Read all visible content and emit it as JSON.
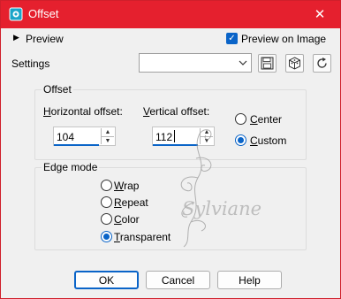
{
  "window": {
    "title": "Offset",
    "close_glyph": "✕"
  },
  "preview": {
    "expander_label": "Preview",
    "preview_on_image_label": "Preview on Image",
    "preview_on_image_checked": true
  },
  "settings": {
    "label": "Settings",
    "preset_value": "",
    "icons": [
      "save-preset-icon",
      "randomize-icon",
      "reset-icon"
    ]
  },
  "offset": {
    "group_label": "Offset",
    "horizontal": {
      "label_accel": "H",
      "label_rest": "orizontal offset:",
      "value": "104"
    },
    "vertical": {
      "label_accel": "V",
      "label_rest": "ertical offset:",
      "value": "112"
    },
    "origin": [
      {
        "accel": "C",
        "rest": "enter",
        "selected": false
      },
      {
        "accel": "C",
        "rest": "ustom",
        "selected": true
      }
    ]
  },
  "edge_mode": {
    "group_label": "Edge mode",
    "options": [
      {
        "accel": "W",
        "rest": "rap",
        "selected": false
      },
      {
        "accel": "R",
        "rest": "epeat",
        "selected": false
      },
      {
        "accel": "C",
        "rest": "olor",
        "selected": false
      },
      {
        "accel": "T",
        "rest": "ransparent",
        "selected": true
      }
    ]
  },
  "watermark": {
    "text": "Sylviane"
  },
  "buttons": {
    "ok": "OK",
    "cancel": "Cancel",
    "help": "Help"
  },
  "colors": {
    "titlebar": "#e5202e",
    "accent": "#0a64c8",
    "background": "#f0f0f0"
  }
}
